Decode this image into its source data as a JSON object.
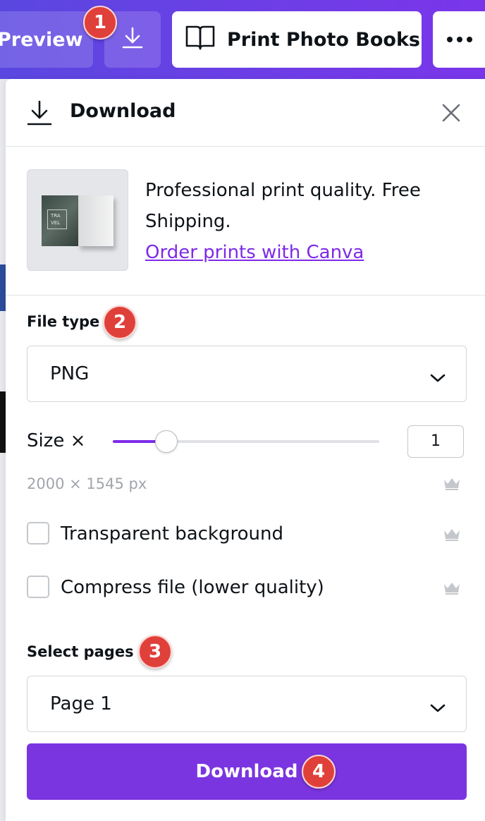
{
  "toolbar": {
    "preview_label": "Preview",
    "download_icon": "download-icon",
    "print_label": "Print Photo Books",
    "print_icon": "open-book-icon",
    "more_icon": "more-dots-icon"
  },
  "markers": [
    "1",
    "2",
    "3",
    "4"
  ],
  "panel": {
    "title": "Download",
    "close_icon": "close-icon",
    "promo": {
      "text": "Professional print quality. Free Shipping.",
      "link": "Order prints with Canva",
      "thumb_text": "TRA VEL"
    },
    "file_type": {
      "label": "File type",
      "value": "PNG"
    },
    "size": {
      "label": "Size ×",
      "value": "1",
      "slider_fraction": 0.2,
      "dimensions": "2000 × 1545 px"
    },
    "options": [
      {
        "label": "Transparent background",
        "checked": false,
        "pro": true
      },
      {
        "label": "Compress file (lower quality)",
        "checked": false,
        "pro": true
      }
    ],
    "pages": {
      "label": "Select pages",
      "value": "Page 1"
    },
    "download_button": "Download"
  },
  "colors": {
    "accent": "#7d2ae8",
    "marker": "#e0403a",
    "toolbar_start": "#5a47e0",
    "toolbar_end": "#7a35ea"
  }
}
